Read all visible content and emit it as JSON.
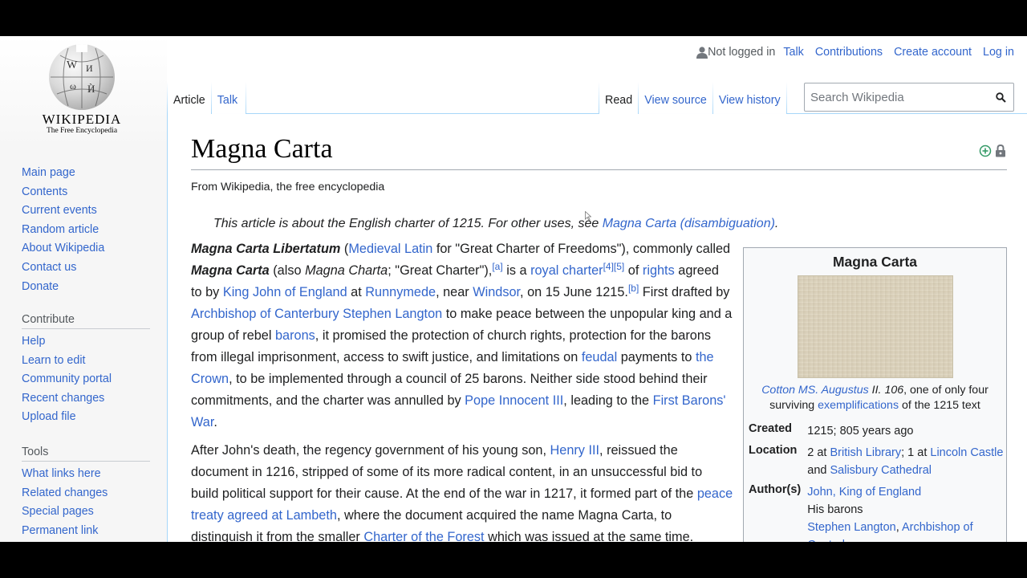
{
  "logo": {
    "wordmark": "Wikipedia",
    "tagline": "The Free Encyclopedia"
  },
  "nav": {
    "main": [
      "Main page",
      "Contents",
      "Current events",
      "Random article",
      "About Wikipedia",
      "Contact us",
      "Donate"
    ],
    "contribute_heading": "Contribute",
    "contribute": [
      "Help",
      "Learn to edit",
      "Community portal",
      "Recent changes",
      "Upload file"
    ],
    "tools_heading": "Tools",
    "tools": [
      "What links here",
      "Related changes",
      "Special pages",
      "Permanent link"
    ]
  },
  "personal": {
    "status": "Not logged in",
    "links": [
      "Talk",
      "Contributions",
      "Create account",
      "Log in"
    ]
  },
  "tabs": {
    "article": "Article",
    "talk": "Talk",
    "read": "Read",
    "view_source": "View source",
    "view_history": "View history"
  },
  "search": {
    "placeholder": "Search Wikipedia"
  },
  "page": {
    "title": "Magna Carta",
    "tagline": "From Wikipedia, the free encyclopedia",
    "hatnote_text": "This article is about the English charter of 1215. For other uses, see ",
    "hatnote_link": "Magna Carta (disambiguation)",
    "hatnote_end": "."
  },
  "paragraph1": {
    "t1": "Magna Carta Libertatum",
    "t2": " (",
    "l1": "Medieval Latin",
    "t3": " for \"Great Charter of Freedoms\"), commonly called ",
    "t4": "Magna Carta",
    "t5": " (also ",
    "t6": "Magna Charta",
    "t7": "; \"Great Charter\"),",
    "s1": "[a]",
    "t8": " is a ",
    "l2": "royal charter",
    "s2": "[4]",
    "s3": "[5]",
    "t9": " of ",
    "l3": "rights",
    "t10": " agreed to by ",
    "l4": "King John of England",
    "t11": " at ",
    "l5": "Runnymede",
    "t12": ", near ",
    "l6": "Windsor",
    "t13": ", on 15 June 1215.",
    "s4": "[b]",
    "t14": " First drafted by ",
    "l7": "Archbishop of Canterbury Stephen Langton",
    "t15": " to make peace between the unpopular king and a group of rebel ",
    "l8": "barons",
    "t16": ", it promised the protection of church rights, protection for the barons from illegal imprisonment, access to swift justice, and limitations on ",
    "l9": "feudal",
    "t17": " payments to ",
    "l10": "the Crown",
    "t18": ", to be implemented through a council of 25 barons. Neither side stood behind their commitments, and the charter was annulled by ",
    "l11": "Pope Innocent III",
    "t19": ", leading to the ",
    "l12": "First Barons' War",
    "t20": "."
  },
  "paragraph2": {
    "t1": "After John's death, the regency government of his young son, ",
    "l1": "Henry III",
    "t2": ", reissued the document in 1216, stripped of some of its more radical content, in an unsuccessful bid to build political support for their cause. At the end of the war in 1217, it formed part of the ",
    "l2": "peace treaty agreed at Lambeth",
    "t3": ", where the document acquired the name Magna Carta, to distinguish it from the smaller ",
    "l3": "Charter of the Forest",
    "t4": " which was issued at the same time."
  },
  "infobox": {
    "title": "Magna Carta",
    "caption_link": "Cotton MS. Augustus",
    "caption_italic": " II. 106",
    "caption_t1": ", one of only four surviving ",
    "caption_link2": "exemplifications",
    "caption_t2": " of the 1215 text",
    "created_label": "Created",
    "created_value": "1215; 805 years ago",
    "location_label": "Location",
    "location_t1": "2 at ",
    "location_l1": "British Library",
    "location_t2": "; 1 at ",
    "location_l2": "Lincoln Castle",
    "location_t3": " and ",
    "location_l3": "Salisbury Cathedral",
    "authors_label": "Author(s)",
    "author_l1": "John, King of England",
    "author_t1": "His barons",
    "author_l2": "Stephen Langton",
    "author_t2": ", ",
    "author_l3": "Archbishop of Canterbury"
  },
  "colors": {
    "link": "#3366cc",
    "tab_border": "#a7d7f9",
    "text": "#202122"
  },
  "icons": [
    "user-icon",
    "search-icon",
    "plus-circle-icon",
    "lock-icon",
    "wikipedia-globe-logo"
  ]
}
